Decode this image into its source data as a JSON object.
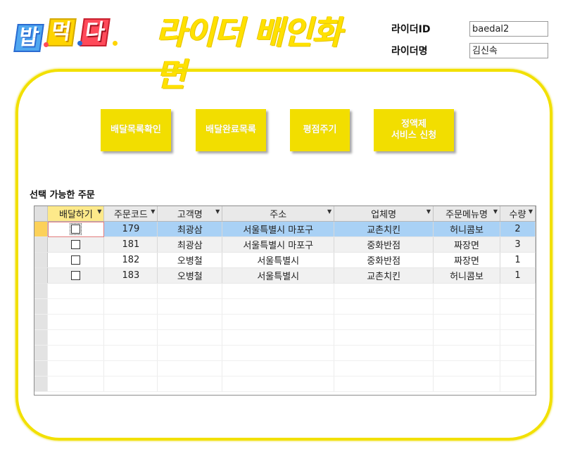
{
  "logo": {
    "part1": "밥",
    "part2": "먹",
    "part3": "다"
  },
  "header": {
    "title": "라이더 배인화면",
    "rider_id_label": "라이더ID",
    "rider_id_value": "baedal2",
    "rider_name_label": "라이더명",
    "rider_name_value": "김신속"
  },
  "buttons": {
    "delivery_list": "배달목록확인",
    "completed_list": "배달완료목록",
    "rating": "평점주기",
    "subscription": "정액제\n서비스 신청"
  },
  "orders": {
    "section_title": "선택 가능한 주문",
    "columns": [
      "배달하기",
      "주문코드",
      "고객명",
      "주소",
      "업체명",
      "주문메뉴명",
      "수량"
    ],
    "rows": [
      {
        "checked": false,
        "code": "179",
        "customer": "최광삼",
        "address": "서울특별시 마포구",
        "store": "교촌치킨",
        "menu": "허니콤보",
        "qty": "2"
      },
      {
        "checked": false,
        "code": "181",
        "customer": "최광삼",
        "address": "서울특별시 마포구",
        "store": "중화반점",
        "menu": "짜장면",
        "qty": "3"
      },
      {
        "checked": false,
        "code": "182",
        "customer": "오병철",
        "address": "서울특별시",
        "store": "중화반점",
        "menu": "짜장면",
        "qty": "1"
      },
      {
        "checked": false,
        "code": "183",
        "customer": "오병철",
        "address": "서울특별시",
        "store": "교촌치킨",
        "menu": "허니콤보",
        "qty": "1"
      }
    ]
  },
  "colors": {
    "accent_yellow": "#f2de00",
    "selected_row": "#a9d1f5",
    "selector_active": "#fcd15a"
  }
}
